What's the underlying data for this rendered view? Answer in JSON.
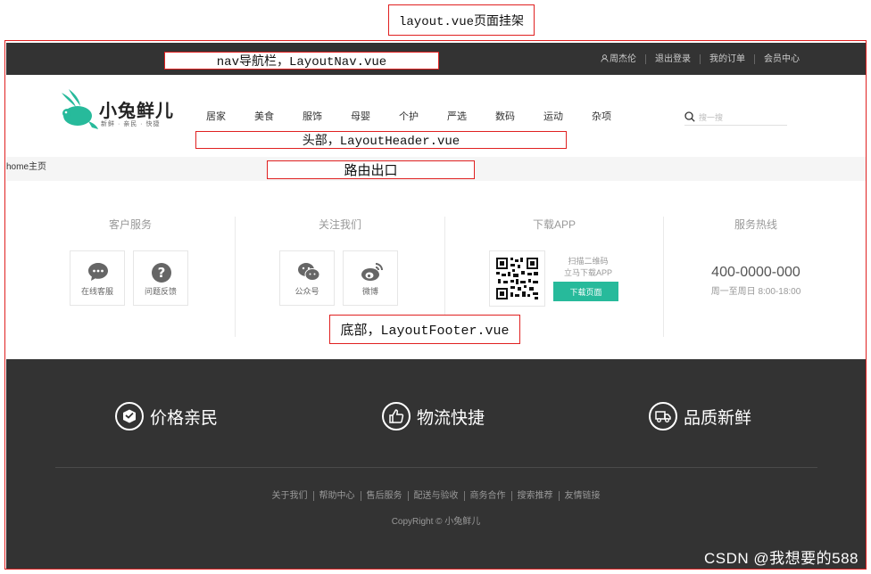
{
  "annotations": {
    "layout": "layout.vue页面挂架",
    "nav": "nav导航栏，LayoutNav.vue",
    "header": "头部，LayoutHeader.vue",
    "route": "路由出口",
    "footer": "底部，LayoutFooter.vue"
  },
  "topnav": {
    "user": "周杰伦",
    "logout": "退出登录",
    "orders": "我的订单",
    "member": "会员中心"
  },
  "header": {
    "logo_name": "小兔鲜儿",
    "logo_slogan": "新鲜 · 亲民 · 快捷",
    "menu": [
      "居家",
      "美食",
      "服饰",
      "母婴",
      "个护",
      "严选",
      "数码",
      "运动",
      "杂项"
    ],
    "search_placeholder": "搜一搜"
  },
  "route": {
    "text": "home主页"
  },
  "footer": {
    "service_title": "客户服务",
    "service_items": [
      "在线客服",
      "问题反馈"
    ],
    "follow_title": "关注我们",
    "follow_items": [
      "公众号",
      "微博"
    ],
    "app_title": "下载APP",
    "app_scan_1": "扫描二维码",
    "app_scan_2": "立马下载APP",
    "app_button": "下载页面",
    "hotline_title": "服务热线",
    "hotline_number": "400-0000-000",
    "hotline_time": "周一至周日 8:00-18:00",
    "features": [
      "价格亲民",
      "物流快捷",
      "品质新鲜"
    ],
    "links": [
      "关于我们",
      "帮助中心",
      "售后服务",
      "配送与验收",
      "商务合作",
      "搜索推荐",
      "友情链接"
    ],
    "copyright": "CopyRight © 小兔鲜儿"
  },
  "watermark": "CSDN @我想要的588",
  "colors": {
    "brand": "#27ba9b",
    "dark": "#333333",
    "annotation": "#e02020"
  }
}
